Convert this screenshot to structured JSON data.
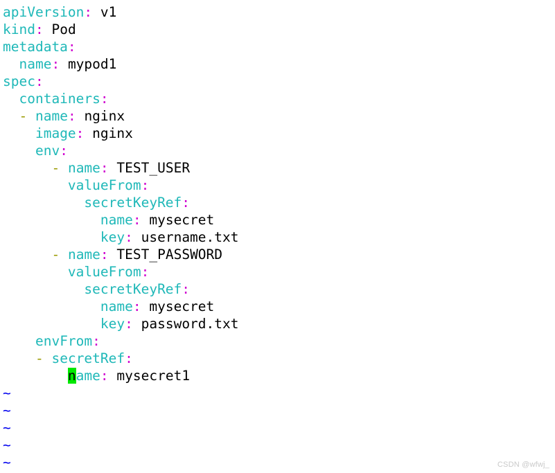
{
  "editor": {
    "app": "vim",
    "file_type": "yaml",
    "background_color": "#ffffff",
    "colors": {
      "key": "#1fb8b8",
      "colon": "#d000d0",
      "value": "#000000",
      "dash": "#9a9a00",
      "tilde": "#0000ee",
      "cursor_bg": "#00e800",
      "cursor_fg": "#000000",
      "watermark": "#c9c9c9"
    }
  },
  "document": {
    "lines": [
      {
        "indent": 0,
        "dash": false,
        "key": "apiVersion",
        "colon": ":",
        "value": "v1"
      },
      {
        "indent": 0,
        "dash": false,
        "key": "kind",
        "colon": ":",
        "value": "Pod"
      },
      {
        "indent": 0,
        "dash": false,
        "key": "metadata",
        "colon": ":",
        "value": ""
      },
      {
        "indent": 2,
        "dash": false,
        "key": "name",
        "colon": ":",
        "value": "mypod1"
      },
      {
        "indent": 0,
        "dash": false,
        "key": "spec",
        "colon": ":",
        "value": ""
      },
      {
        "indent": 2,
        "dash": false,
        "key": "containers",
        "colon": ":",
        "value": ""
      },
      {
        "indent": 2,
        "dash": true,
        "key": "name",
        "colon": ":",
        "value": "nginx"
      },
      {
        "indent": 4,
        "dash": false,
        "key": "image",
        "colon": ":",
        "value": "nginx"
      },
      {
        "indent": 4,
        "dash": false,
        "key": "env",
        "colon": ":",
        "value": ""
      },
      {
        "indent": 6,
        "dash": true,
        "key": "name",
        "colon": ":",
        "value": "TEST_USER"
      },
      {
        "indent": 8,
        "dash": false,
        "key": "valueFrom",
        "colon": ":",
        "value": ""
      },
      {
        "indent": 10,
        "dash": false,
        "key": "secretKeyRef",
        "colon": ":",
        "value": ""
      },
      {
        "indent": 12,
        "dash": false,
        "key": "name",
        "colon": ":",
        "value": "mysecret"
      },
      {
        "indent": 12,
        "dash": false,
        "key": "key",
        "colon": ":",
        "value": "username.txt"
      },
      {
        "indent": 6,
        "dash": true,
        "key": "name",
        "colon": ":",
        "value": "TEST_PASSWORD"
      },
      {
        "indent": 8,
        "dash": false,
        "key": "valueFrom",
        "colon": ":",
        "value": ""
      },
      {
        "indent": 10,
        "dash": false,
        "key": "secretKeyRef",
        "colon": ":",
        "value": ""
      },
      {
        "indent": 12,
        "dash": false,
        "key": "name",
        "colon": ":",
        "value": "mysecret"
      },
      {
        "indent": 12,
        "dash": false,
        "key": "key",
        "colon": ":",
        "value": "password.txt"
      },
      {
        "indent": 4,
        "dash": false,
        "key": "envFrom",
        "colon": ":",
        "value": ""
      },
      {
        "indent": 4,
        "dash": true,
        "key": "secretRef",
        "colon": ":",
        "value": ""
      },
      {
        "indent": 8,
        "dash": false,
        "key": "name",
        "colon": ":",
        "value": "mysecret1",
        "cursor_index": 0
      }
    ],
    "empty_markers": [
      "~",
      "~",
      "~",
      "~",
      "~"
    ]
  },
  "watermark": {
    "text": "CSDN @wfwj_"
  }
}
